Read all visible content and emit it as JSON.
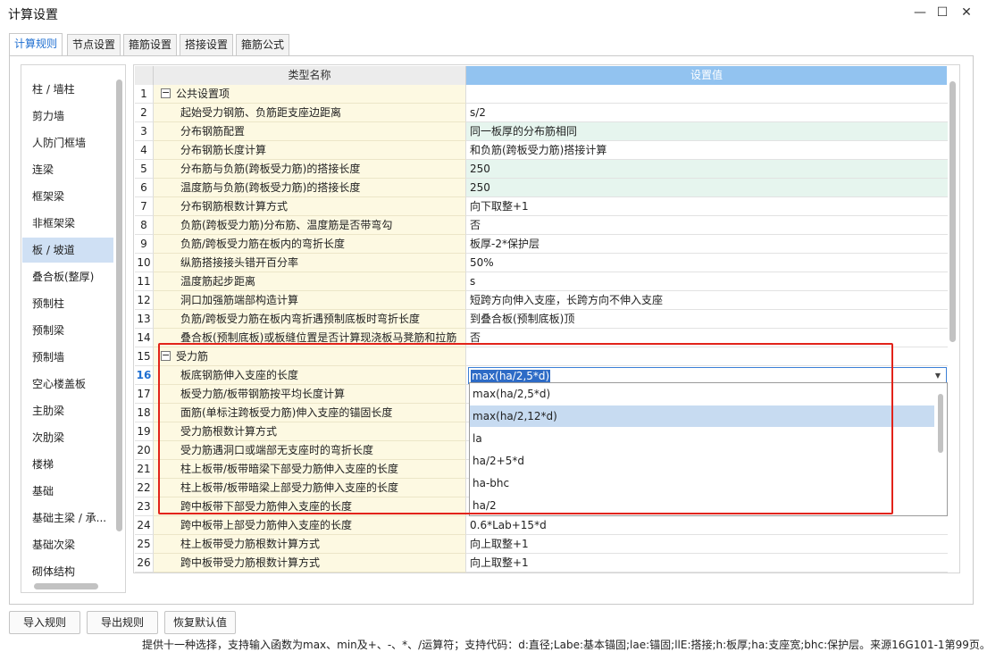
{
  "window": {
    "title": "计算设置"
  },
  "tabs": [
    "计算规则",
    "节点设置",
    "箍筋设置",
    "搭接设置",
    "箍筋公式"
  ],
  "active_tab": "计算规则",
  "sidebar": {
    "items": [
      "柱 / 墙柱",
      "剪力墙",
      "人防门框墙",
      "连梁",
      "框架梁",
      "非框架梁",
      "板 / 坡道",
      "叠合板(整厚)",
      "预制柱",
      "预制梁",
      "预制墙",
      "空心楼盖板",
      "主肋梁",
      "次肋梁",
      "楼梯",
      "基础",
      "基础主梁 / 承...",
      "基础次梁",
      "砌体结构"
    ],
    "selected": "板 / 坡道"
  },
  "grid": {
    "header_name": "类型名称",
    "header_value": "设置值",
    "rows": [
      {
        "num": "1",
        "name": "公共设置项",
        "value": ""
      },
      {
        "num": "2",
        "name": "起始受力钢筋、负筋距支座边距离",
        "value": "s/2"
      },
      {
        "num": "3",
        "name": "分布钢筋配置",
        "value": "同一板厚的分布筋相同"
      },
      {
        "num": "4",
        "name": "分布钢筋长度计算",
        "value": "和负筋(跨板受力筋)搭接计算"
      },
      {
        "num": "5",
        "name": "分布筋与负筋(跨板受力筋)的搭接长度",
        "value": "250"
      },
      {
        "num": "6",
        "name": "温度筋与负筋(跨板受力筋)的搭接长度",
        "value": "250"
      },
      {
        "num": "7",
        "name": "分布钢筋根数计算方式",
        "value": "向下取整+1"
      },
      {
        "num": "8",
        "name": "负筋(跨板受力筋)分布筋、温度筋是否带弯勾",
        "value": "否"
      },
      {
        "num": "9",
        "name": "负筋/跨板受力筋在板内的弯折长度",
        "value": "板厚-2*保护层"
      },
      {
        "num": "10",
        "name": "纵筋搭接接头错开百分率",
        "value": "50%"
      },
      {
        "num": "11",
        "name": "温度筋起步距离",
        "value": "s"
      },
      {
        "num": "12",
        "name": "洞口加强筋端部构造计算",
        "value": "短跨方向伸入支座，长跨方向不伸入支座"
      },
      {
        "num": "13",
        "name": "负筋/跨板受力筋在板内弯折遇预制底板时弯折长度",
        "value": "到叠合板(预制底板)顶"
      },
      {
        "num": "14",
        "name": "叠合板(预制底板)或板缝位置是否计算现浇板马凳筋和拉筋",
        "value": "否"
      },
      {
        "num": "15",
        "name": "受力筋",
        "value": ""
      },
      {
        "num": "16",
        "name": "板底钢筋伸入支座的长度",
        "value": "max(ha/2,5*d)"
      },
      {
        "num": "17",
        "name": "板受力筋/板带钢筋按平均长度计算",
        "value": ""
      },
      {
        "num": "18",
        "name": "面筋(单标注跨板受力筋)伸入支座的锚固长度",
        "value": ""
      },
      {
        "num": "19",
        "name": "受力筋根数计算方式",
        "value": ""
      },
      {
        "num": "20",
        "name": "受力筋遇洞口或端部无支座时的弯折长度",
        "value": ""
      },
      {
        "num": "21",
        "name": "柱上板带/板带暗梁下部受力筋伸入支座的长度",
        "value": ""
      },
      {
        "num": "22",
        "name": "柱上板带/板带暗梁上部受力筋伸入支座的长度",
        "value": ""
      },
      {
        "num": "23",
        "name": "跨中板带下部受力筋伸入支座的长度",
        "value": ""
      },
      {
        "num": "24",
        "name": "跨中板带上部受力筋伸入支座的长度",
        "value": "0.6*Lab+15*d"
      },
      {
        "num": "25",
        "name": "柱上板带受力筋根数计算方式",
        "value": "向上取整+1"
      },
      {
        "num": "26",
        "name": "跨中板带受力筋根数计算方式",
        "value": "向上取整+1"
      }
    ],
    "editing_value": "max(ha/2,5*d)"
  },
  "dropdown": {
    "options": [
      "max(ha/2,5*d)",
      "max(ha/2,12*d)",
      "la",
      "ha/2+5*d",
      "ha-bhc",
      "ha/2"
    ],
    "highlighted": "max(ha/2,12*d)"
  },
  "hint": "提供十一种选择，支持输入函数为max、min及+、-、*、/运算符；支持代码：d:直径;Labe:基本锚固;lae:锚固;llE:搭接;h:板厚;ha:支座宽;bhc:保护层。来源16G101-1第99页。",
  "buttons": {
    "import": "导入规则",
    "export": "导出规则",
    "restore": "恢复默认值"
  },
  "colors": {
    "accent": "#1f6fd1",
    "header_value_bg": "#92c3f0",
    "name_cell_bg": "#fdf9e2",
    "highlight_value_bg": "#e6f5ee",
    "annotation_red": "#e2231a"
  },
  "icons": {
    "minimize": "minimize-icon",
    "maximize": "maximize-icon",
    "close": "close-icon",
    "collapse": "collapse-icon",
    "dropdown_arrow": "dropdown-arrow-icon"
  }
}
